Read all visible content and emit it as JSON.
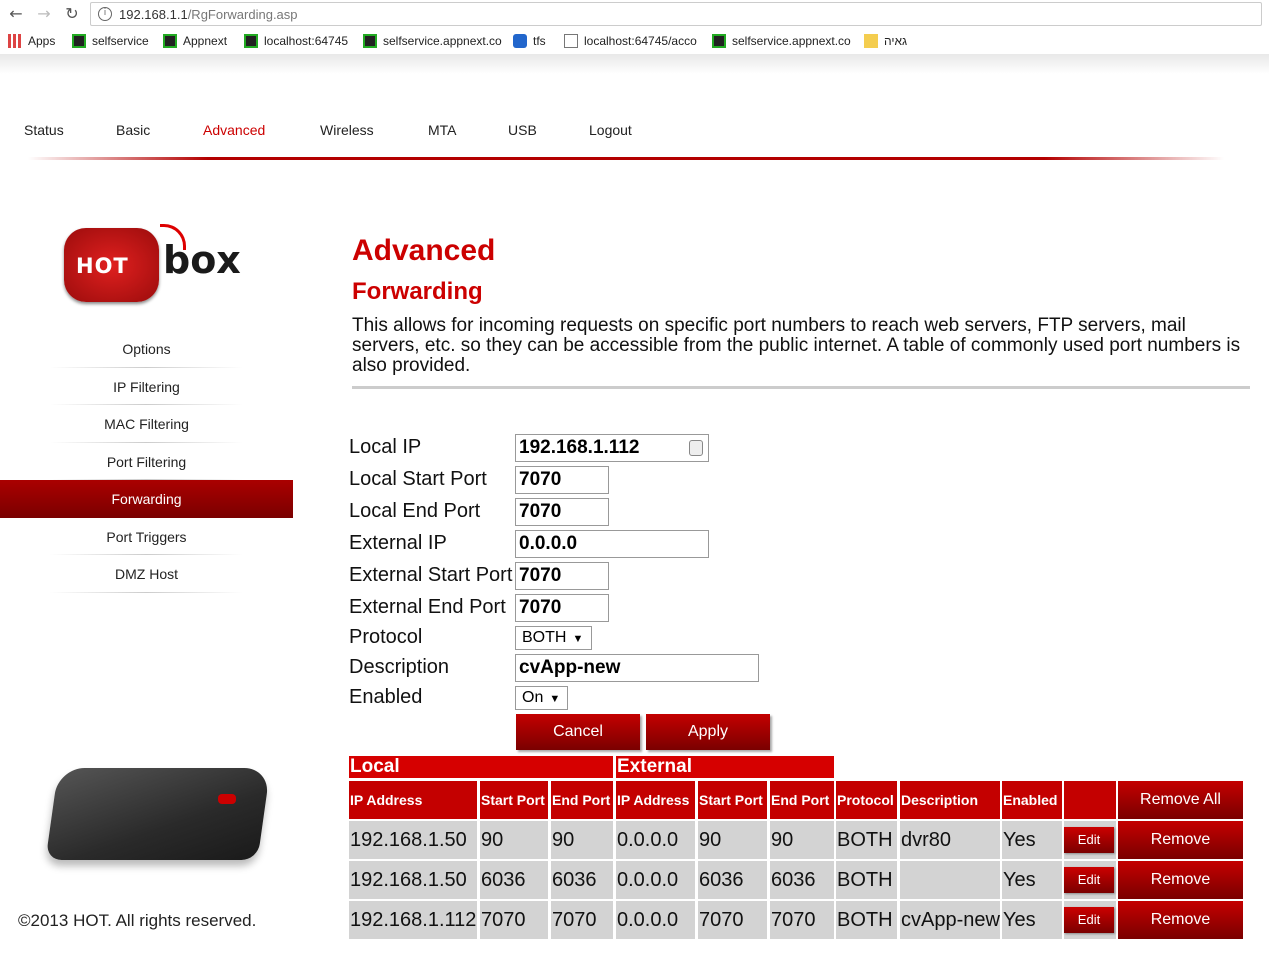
{
  "browser": {
    "url_host": "192.168.1.1",
    "url_path": "/RgForwarding.asp",
    "bookmarks": [
      "Apps",
      "selfservice",
      "Appnext",
      "localhost:64745",
      "selfservice.appnext.co",
      "tfs",
      "localhost:64745/acco",
      "selfservice.appnext.co",
      "גאיה"
    ],
    "back_icon": "arrow-left-icon",
    "forward_icon": "arrow-right-icon",
    "reload_icon": "reload-icon"
  },
  "topnav": [
    "Status",
    "Basic",
    "Advanced",
    "Wireless",
    "MTA",
    "USB",
    "Logout"
  ],
  "logo": {
    "hot": "HOT",
    "box": "box"
  },
  "sidenav": [
    "Options",
    "IP Filtering",
    "MAC Filtering",
    "Port Filtering",
    "Forwarding",
    "Port Triggers",
    "DMZ Host"
  ],
  "footer": "©2013 HOT. All rights reserved.",
  "page": {
    "title": "Advanced",
    "subtitle": "Forwarding",
    "description": "This allows for incoming requests on specific port numbers to reach web servers, FTP servers, mail servers, etc. so they can be accessible from the public internet. A table of commonly used port numbers is also provided."
  },
  "form": {
    "local_ip_label": "Local IP",
    "local_ip": "192.168.1.112",
    "local_start_port_label": "Local Start Port",
    "local_start_port": "7070",
    "local_end_port_label": "Local End Port",
    "local_end_port": "7070",
    "external_ip_label": "External IP",
    "external_ip": "0.0.0.0",
    "external_start_port_label": "External Start Port",
    "external_start_port": "7070",
    "external_end_port_label": "External End Port",
    "external_end_port": "7070",
    "protocol_label": "Protocol",
    "protocol": "BOTH",
    "description_label": "Description",
    "description": "cvApp-new",
    "enabled_label": "Enabled",
    "enabled": "On",
    "cancel": "Cancel",
    "apply": "Apply"
  },
  "table": {
    "group_local": "Local",
    "group_external": "External",
    "headers": [
      "IP Address",
      "Start Port",
      "End Port",
      "IP Address",
      "Start Port",
      "End Port",
      "Protocol",
      "Description",
      "Enabled"
    ],
    "remove_all": "Remove All",
    "edit": "Edit",
    "remove": "Remove",
    "rows": [
      [
        "192.168.1.50",
        "90",
        "90",
        "0.0.0.0",
        "90",
        "90",
        "BOTH",
        "dvr80",
        "Yes"
      ],
      [
        "192.168.1.50",
        "6036",
        "6036",
        "0.0.0.0",
        "6036",
        "6036",
        "BOTH",
        "",
        "Yes"
      ],
      [
        "192.168.1.112",
        "7070",
        "7070",
        "0.0.0.0",
        "7070",
        "7070",
        "BOTH",
        "cvApp-new",
        "Yes"
      ]
    ]
  }
}
